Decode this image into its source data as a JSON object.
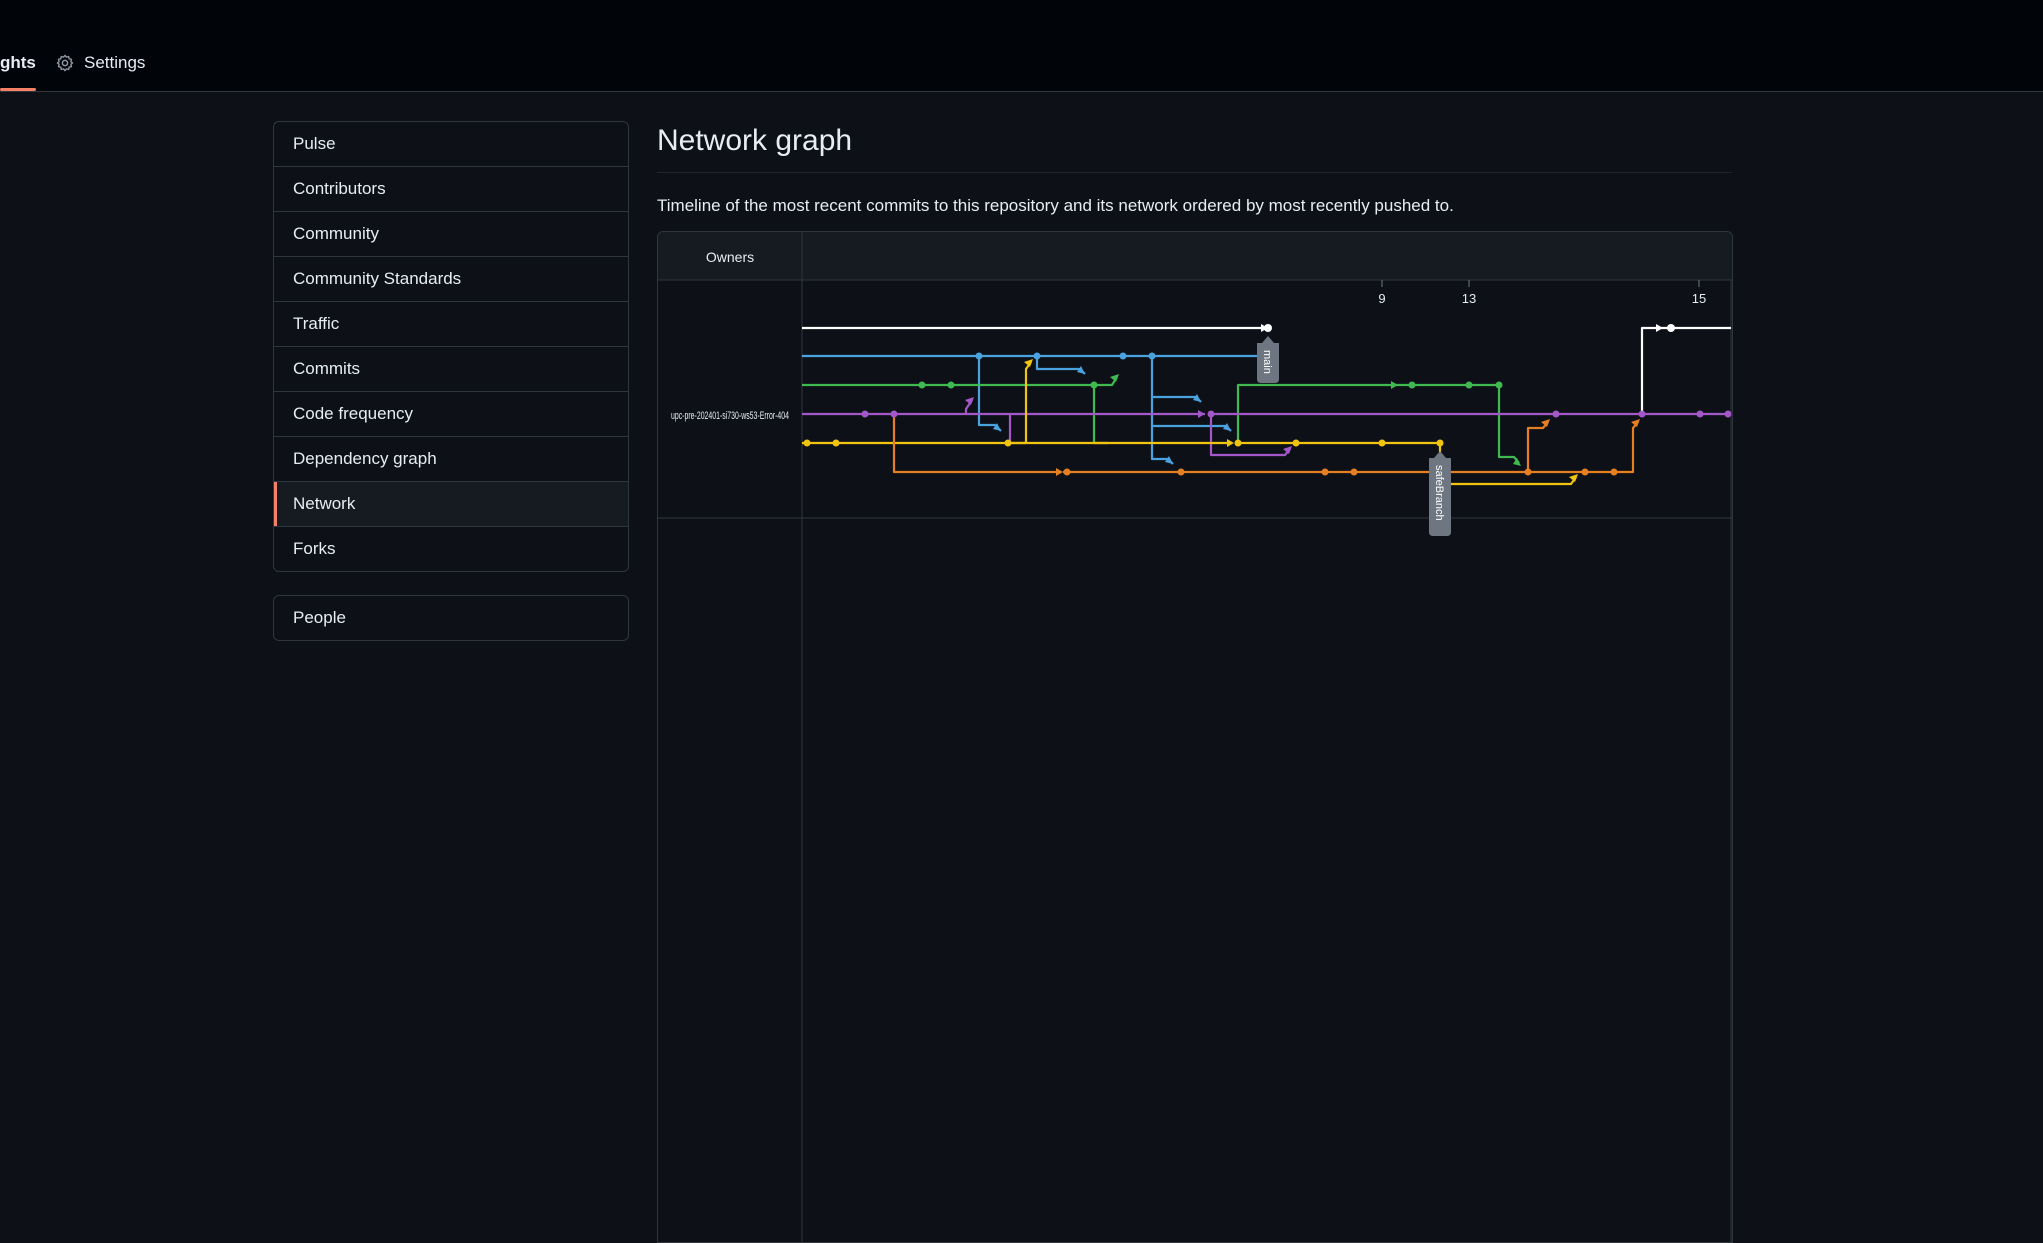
{
  "header": {
    "tabs": [
      {
        "label": "ghts",
        "icon": "graph-icon",
        "selected": true
      },
      {
        "label": "Settings",
        "icon": "gear-icon",
        "selected": false
      }
    ]
  },
  "sidebar": {
    "items": [
      {
        "label": "Pulse"
      },
      {
        "label": "Contributors"
      },
      {
        "label": "Community"
      },
      {
        "label": "Community Standards"
      },
      {
        "label": "Traffic"
      },
      {
        "label": "Commits"
      },
      {
        "label": "Code frequency"
      },
      {
        "label": "Dependency graph"
      },
      {
        "label": "Network",
        "selected": true
      },
      {
        "label": "Forks"
      }
    ],
    "secondary": [
      {
        "label": "People"
      }
    ]
  },
  "main": {
    "title": "Network graph",
    "description": "Timeline of the most recent commits to this repository and its network ordered by most recently pushed to."
  },
  "network_graph": {
    "owners_header": "Owners",
    "owner": "upc-pre-202401-si730-ws53-Error-404",
    "date_labels": [
      "9",
      "13",
      "15"
    ],
    "branch_labels": [
      "main",
      "safeBranch"
    ],
    "colors": {
      "background": "#0d1117",
      "header": "#161b22",
      "grid": "#30363d",
      "white": "#ffffff",
      "blue": "#4aa3df",
      "green": "#3fb950",
      "purple": "#a457c9",
      "yellow": "#f1c40f",
      "orange": "#e67e22",
      "tag": "#6e7681"
    }
  }
}
